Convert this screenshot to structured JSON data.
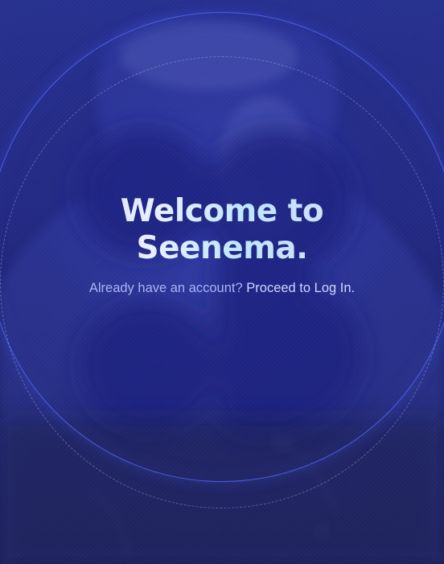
{
  "welcome": {
    "title_line1": "Welcome to",
    "title_line2": "Seenema."
  },
  "login_prompt": {
    "lead_text": "Already have an account?",
    "link_text": "Proceed to Log In."
  },
  "colors": {
    "background": "#232a82",
    "ring": "#586eff",
    "title_gradient_start": "#c9d3ff",
    "title_gradient_end": "#bfe6ff",
    "subtitle": "#b7c0f2"
  }
}
